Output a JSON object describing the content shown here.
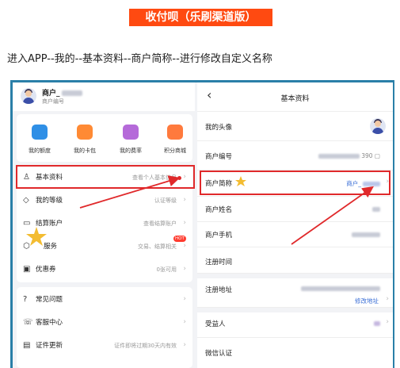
{
  "banner": "收付呗（乐刷渠道版）",
  "instruction": "进入APP--我的--基本资料--商户简称--进行修改自定义名称",
  "left": {
    "merchant_name": "商户_",
    "merchant_sub": "商户编号",
    "quick": [
      {
        "label": "我的额度",
        "color": "#2f8fe6"
      },
      {
        "label": "我的卡包",
        "color": "#ff8a34"
      },
      {
        "label": "我的费率",
        "color": "#b56ad9"
      },
      {
        "label": "积分商城",
        "color": "#ff7a3d"
      }
    ],
    "menu1": [
      {
        "icon": "person-icon",
        "glyph": "♙",
        "label": "基本资料",
        "hint": "查看个人基本信息"
      },
      {
        "icon": "diamond-icon",
        "glyph": "◇",
        "label": "我的等级",
        "hint": "认证等级"
      },
      {
        "icon": "wallet-icon",
        "glyph": "▭",
        "label": "结算账户",
        "hint": "查看结算账户"
      },
      {
        "icon": "cube-icon",
        "glyph": "⬡",
        "label": "服务",
        "hint": "交易、结算相关"
      },
      {
        "icon": "coupon-icon",
        "glyph": "▣",
        "label": "优惠券",
        "hint": "0张可用"
      }
    ],
    "hot_badge": "HOT",
    "menu2": [
      {
        "icon": "question-icon",
        "glyph": "?",
        "label": "常见问题",
        "hint": ""
      },
      {
        "icon": "service-icon",
        "glyph": "☏",
        "label": "客服中心",
        "hint": ""
      },
      {
        "icon": "certificate-icon",
        "glyph": "▤",
        "label": "证件更新",
        "hint": "证件即将过期30天内有效"
      }
    ]
  },
  "right": {
    "back": "‹",
    "title": "基本资料",
    "avatar_label": "我的头像",
    "merchant_no_label": "商户编号",
    "merchant_no_value": "390",
    "short_name_label": "商户简称",
    "short_name_value": "商户_",
    "surname_label": "商户姓名",
    "phone_label": "商户手机",
    "reg_time_label": "注册时间",
    "reg_addr_label": "注册地址",
    "edit_addr": "修改地址",
    "beneficiary_label": "受益人",
    "wechat_label": "微信认证"
  },
  "colors": {
    "banner": "#ff4a11",
    "highlight": "#e0292b",
    "frame": "#2a7fa8",
    "link": "#3b6fd6",
    "star": "#f2b51b"
  }
}
